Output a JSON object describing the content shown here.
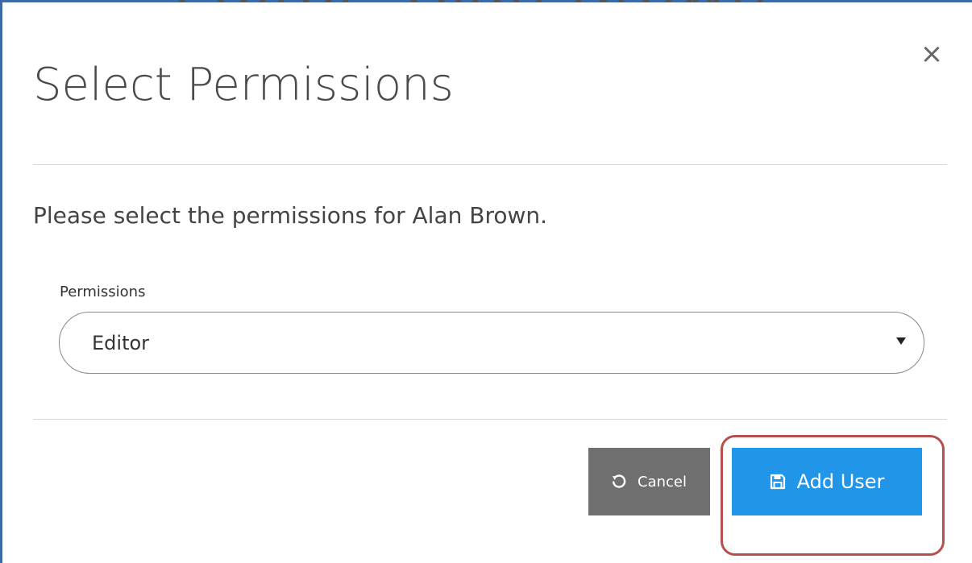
{
  "background": {
    "fragment_text": "Editor: Alan Brown"
  },
  "modal": {
    "title": "Select Permissions",
    "close_symbol": "×",
    "message": "Please select the permissions for Alan Brown.",
    "field": {
      "label": "Permissions",
      "selected_value": "Editor"
    },
    "buttons": {
      "cancel_label": "Cancel",
      "add_label": "Add User"
    }
  },
  "icons": {
    "close": "close-icon",
    "caret": "caret-down-icon",
    "cancel": "undo-icon",
    "add": "save-icon"
  },
  "colors": {
    "primary": "#2196e8",
    "secondary": "#6f6f6f",
    "highlight": "#b5504e",
    "frame": "#3b6aa6"
  }
}
